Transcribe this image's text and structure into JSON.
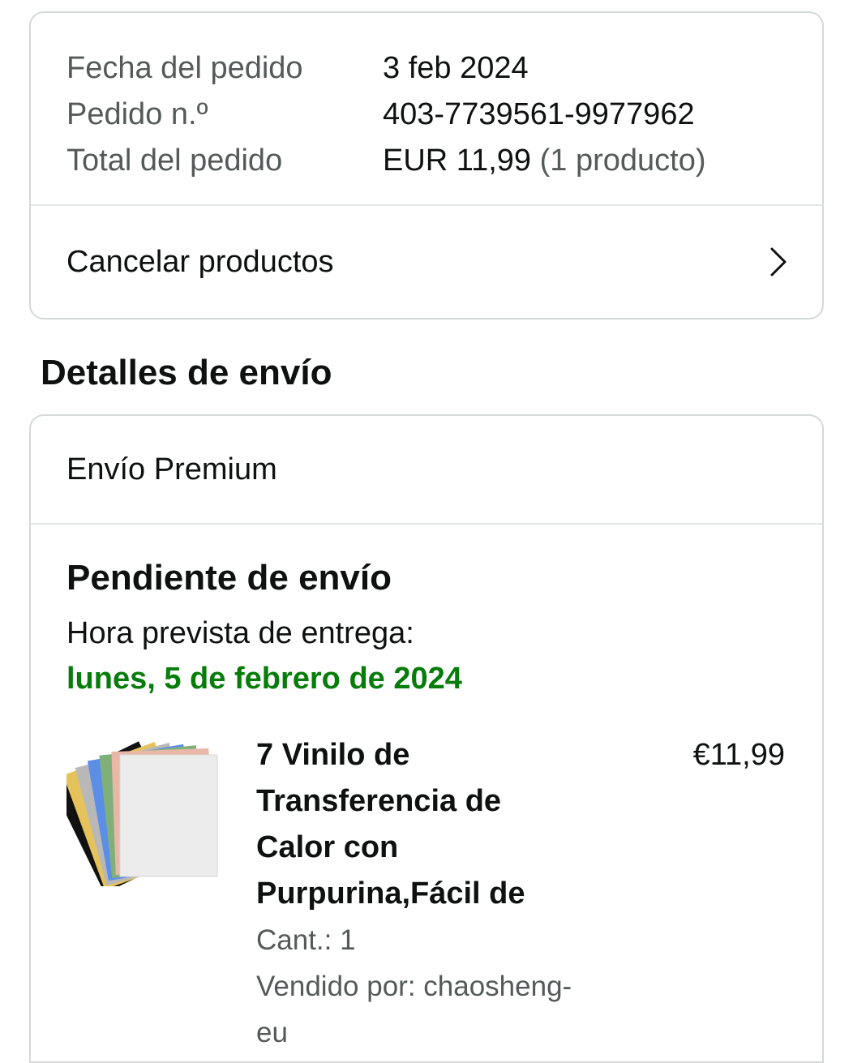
{
  "order_summary": {
    "rows": [
      {
        "label": "Fecha del pedido",
        "value": "3 feb 2024"
      },
      {
        "label": "Pedido n.º",
        "value": "403-7739561-9977962"
      },
      {
        "label": "Total del pedido",
        "value": "EUR 11,99",
        "suffix": "(1 producto)"
      }
    ],
    "cancel_label": "Cancelar productos"
  },
  "shipping": {
    "section_title": "Detalles de envío",
    "method": "Envío Premium",
    "status": "Pendiente de envío",
    "eta_label": "Hora prevista de entrega:",
    "eta_date": "lunes, 5 de febrero de 2024",
    "eta_color": "#067d0a",
    "product": {
      "title_lines": [
        "7 Vinilo de",
        "Transferencia de",
        "Calor con",
        "Purpurina,Fácil de"
      ],
      "price": "€11,99",
      "quantity": "Cant.: 1",
      "seller": "Vendido por: chaosheng-eu",
      "image_icon": "glitter-vinyl-sheets-thumbnail"
    }
  }
}
